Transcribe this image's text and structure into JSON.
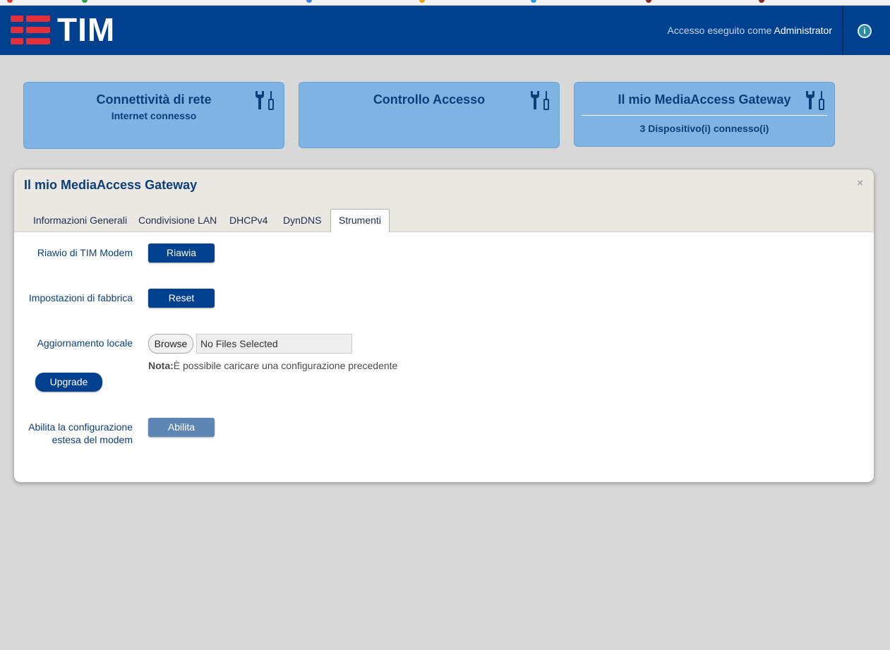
{
  "brand": {
    "name": "TIM",
    "accent": "#e4303d",
    "header_bg": "#00418f"
  },
  "header": {
    "login_prefix": "Accesso eseguito come",
    "user": "Administrator",
    "info_icon": "info-icon"
  },
  "cards": [
    {
      "title": "Connettività di rete",
      "subtitle": "Internet connesso",
      "icon": "tools-icon"
    },
    {
      "title": "Controllo Accesso",
      "subtitle": "",
      "icon": "tools-icon"
    },
    {
      "title": "Il mio MediaAccess Gateway",
      "subtitle": "3 Dispositivo(i) connesso(i)",
      "icon": "tools-icon"
    }
  ],
  "modal": {
    "title": "Il mio MediaAccess Gateway",
    "close": "×",
    "tabs": [
      "Informazioni Generali",
      "Condivisione LAN",
      "DHCPv4",
      "DynDNS",
      "Strumenti"
    ],
    "active_tab": "Strumenti",
    "rows": {
      "restart": {
        "label": "Riawio di TIM Modem",
        "button": "Riawia"
      },
      "factory": {
        "label": "Impostazioni di fabbrica",
        "button": "Reset"
      },
      "upgrade": {
        "label": "Aggiornamento locale",
        "browse": "Browse",
        "file_value": "No Files Selected",
        "note_prefix": "Nota:",
        "note_text": "È possibile caricare una configurazione precedente",
        "button": "Upgrade"
      },
      "extended": {
        "label_line1": "Abilita la configurazione",
        "label_line2": "estesa del modem",
        "button": "Abilita"
      }
    }
  }
}
